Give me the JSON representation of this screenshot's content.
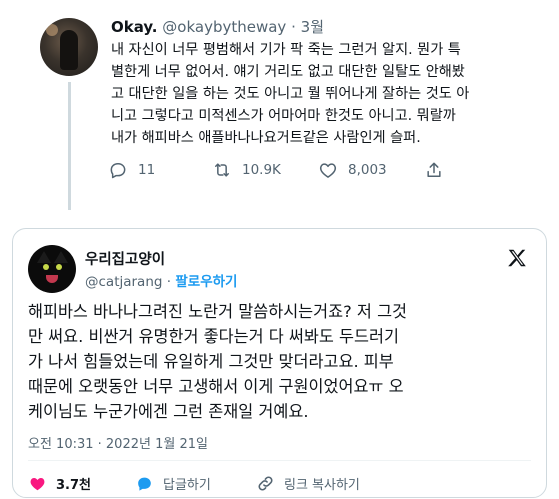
{
  "tweet": {
    "name": "Okay.",
    "handle": "@okaybytheway",
    "dot": "·",
    "time": "3월",
    "lines": [
      "내 자신이 너무 평범해서 기가 팍 죽는 그런거 알지. 뭔가 특",
      "별한게 너무 없어서. 얘기 거리도 없고 대단한 일탈도 안해봤",
      "고 대단한 일을 하는 것도 아니고 뭘 뛰어나게 잘하는 것도 아",
      "니고 그렇다고 미적센스가 어마어마 한것도 아니고. 뭐랄까",
      "내가 해피바스 애플바나나요거트같은 사람인게 슬퍼."
    ],
    "actions": {
      "replies": "11",
      "retweets": "10.9K",
      "likes": "8,003"
    }
  },
  "quoted": {
    "name": "우리집고양이",
    "handle": "@catjarang",
    "dot": "·",
    "follow_label": "팔로우하기",
    "lines": [
      "해피바스 바나나그려진 노란거 말씀하시는거죠? 저 그것",
      "만 써요. 비싼거 유명한거 좋다는거 다 써봐도 두드러기",
      "가 나서 힘들었는데 유일하게 그것만 맞더라고요. 피부",
      "때문에 오랫동안 너무 고생해서 이게 구원이었어요ㅠ 오",
      "케이님도 누군가에겐 그런 존재일 거예요."
    ],
    "timestamp": "오전 10:31 · 2022년 1월 21일",
    "actions": {
      "likes": "3.7천",
      "reply_label": "답글하기",
      "copy_link_label": "링크 복사하기"
    }
  },
  "colors": {
    "text": "#0f1419",
    "secondary": "#536471",
    "accent": "#1d9bf0",
    "like": "#f91880",
    "border": "#cfd9de"
  },
  "icons": [
    "reply-icon",
    "retweet-icon",
    "like-icon",
    "share-icon",
    "x-logo-icon",
    "heart-filled-icon",
    "reply-bubble-icon",
    "link-icon"
  ]
}
